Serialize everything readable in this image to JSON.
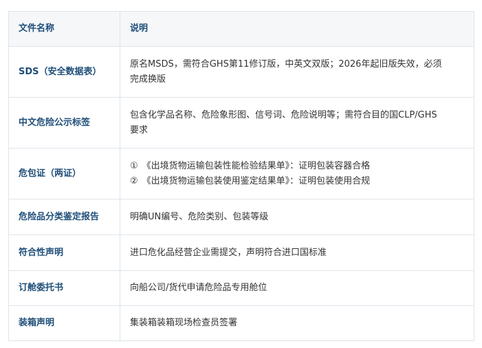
{
  "table": {
    "headers": [
      "文件名称",
      "说明"
    ],
    "rows": [
      {
        "name": "SDS（安全数据表）",
        "desc_lines": [
          "原名MSDS，需符合GHS第11修订版，中英文双版；2026年起旧版失效，必须",
          "完成换版"
        ]
      },
      {
        "name": "中文危险公示标签",
        "desc_lines": [
          "包含化学品名称、危险象形图、信号词、危险说明等；需符合目的国CLP/GHS",
          "要求"
        ]
      },
      {
        "name": "危包证（两证）",
        "desc_items": [
          {
            "marker": "①",
            "text": "《出境货物运输包装性能检验结果单》：证明包装容器合格"
          },
          {
            "marker": "②",
            "text": "《出境货物运输包装使用鉴定结果单》：证明包装使用合规"
          }
        ]
      },
      {
        "name": "危险品分类鉴定报告",
        "desc_lines": [
          "明确UN编号、危险类别、包装等级"
        ]
      },
      {
        "name": "符合性声明",
        "desc_lines": [
          "进口危化品经营企业需提交，声明符合进口国标准"
        ]
      },
      {
        "name": "订舱委托书",
        "desc_lines": [
          "向船公司/货代申请危险品专用舱位"
        ]
      },
      {
        "name": "装箱声明",
        "desc_lines": [
          "集装箱装箱现场检查员签署"
        ]
      }
    ]
  },
  "colors": {
    "header_bg": "#f5f7f9",
    "border": "#dfe4ea",
    "name_text": "#1f4e79",
    "body_text": "#333333"
  }
}
